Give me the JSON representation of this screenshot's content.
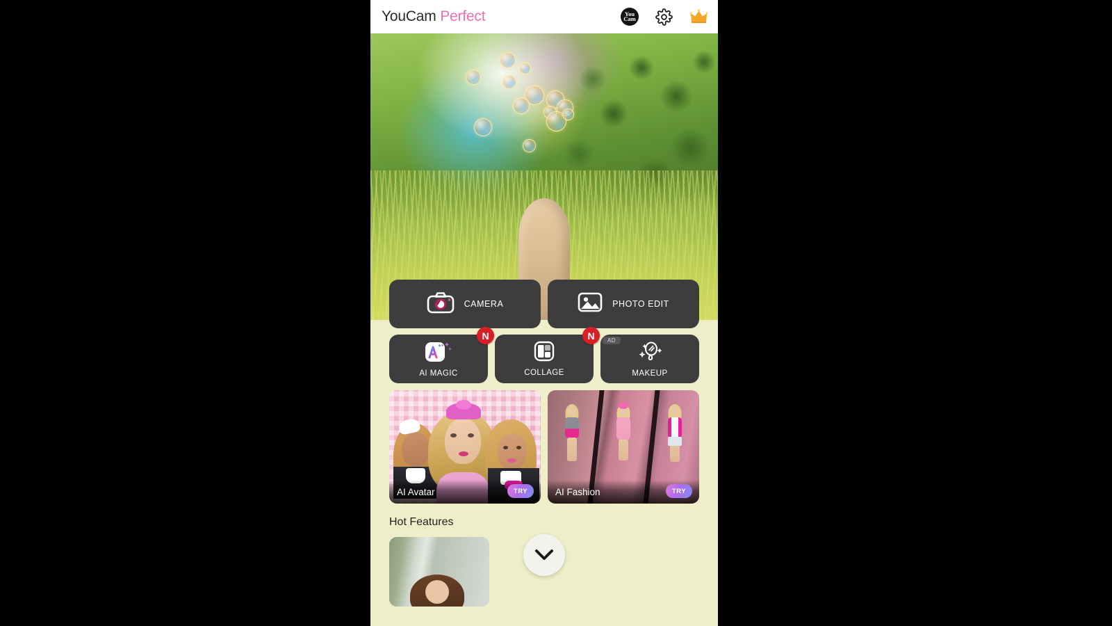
{
  "app": {
    "brand_first": "YouCam",
    "brand_second": "Perfect",
    "background_color": "#eeeec8",
    "header_background": "#ffffff",
    "brand_accent": "#ef6fb0"
  },
  "header": {
    "icons": [
      {
        "name": "youcam-badge-icon",
        "line1": "You",
        "line2": "Cam"
      },
      {
        "name": "settings-gear-icon"
      },
      {
        "name": "premium-crown-icon"
      }
    ]
  },
  "hero": {
    "alt": "Woman with long blonde hair seen from behind standing in tall sunlit grass with soap bubbles and rainbow light"
  },
  "main_actions": [
    {
      "label": "CAMERA",
      "icon": "camera-icon"
    },
    {
      "label": "PHOTO EDIT",
      "icon": "photo-icon"
    }
  ],
  "secondary_actions": [
    {
      "label": "AI MAGIC",
      "icon": "ai-magic-icon",
      "badge": "N",
      "badge_color": "#d81f26"
    },
    {
      "label": "COLLAGE",
      "icon": "collage-icon",
      "badge": "N",
      "badge_color": "#d81f26"
    },
    {
      "label": "MAKEUP",
      "icon": "makeup-mirror-icon",
      "ad_label": "AD"
    }
  ],
  "promos": [
    {
      "title": "AI Avatar",
      "cta": "TRY"
    },
    {
      "title": "AI Fashion",
      "cta": "TRY"
    }
  ],
  "fab": {
    "name": "expand-chevron-down",
    "glyph": "⌄"
  },
  "hot_features": {
    "title": "Hot Features",
    "cards": [
      {
        "name": "hot-feature-card-1"
      }
    ]
  }
}
